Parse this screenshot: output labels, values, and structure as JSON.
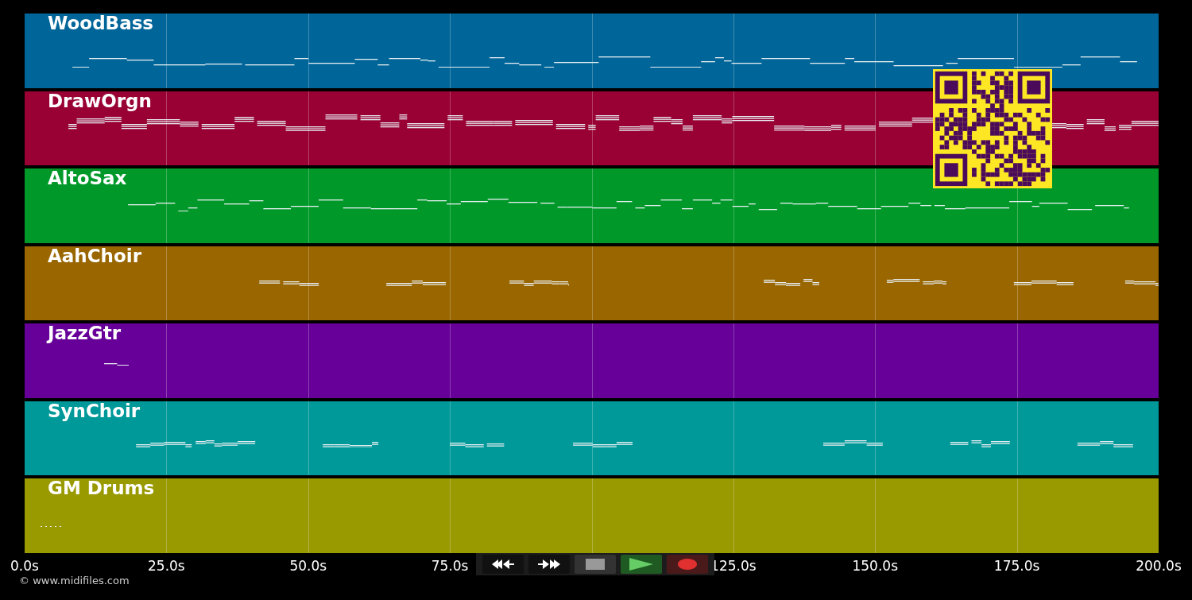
{
  "tracks": [
    {
      "name": "WoodBass",
      "color": "#006699"
    },
    {
      "name": "DrawOrgn",
      "color": "#990033"
    },
    {
      "name": "AltoSax",
      "color": "#009929"
    },
    {
      "name": "AahChoir",
      "color": "#996600"
    },
    {
      "name": "JazzGtr",
      "color": "#660099"
    },
    {
      "name": "SynChoir",
      "color": "#009999"
    },
    {
      "name": "GM Drums",
      "color": "#999900"
    }
  ],
  "axis": {
    "ticks_before_controls": [
      "0.0s",
      "25.0s",
      "50.0s",
      "75.0s"
    ],
    "ticks_after_controls": [
      "125.0s",
      "150.0s",
      "175.0s",
      "200.0s"
    ]
  },
  "transport": [
    {
      "kind": "rewind"
    },
    {
      "kind": "forward"
    },
    {
      "kind": "stop"
    },
    {
      "kind": "play"
    },
    {
      "kind": "record"
    }
  ],
  "credit": "© www.midifiles.com"
}
